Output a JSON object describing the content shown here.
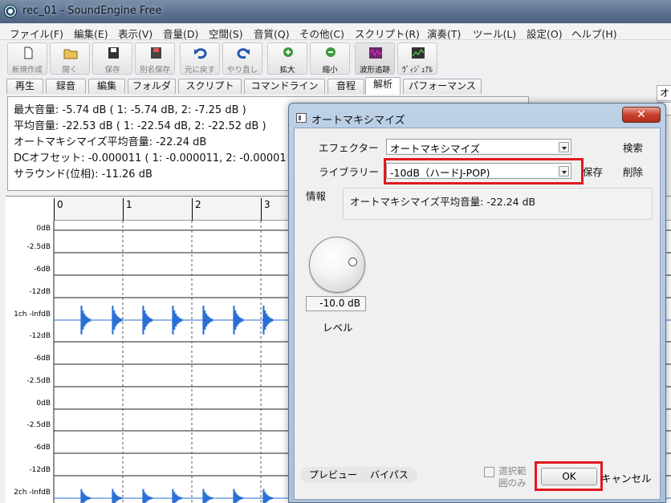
{
  "window": {
    "title": "rec_01 - SoundEngine Free"
  },
  "menu": [
    "ファイル(F)",
    "編集(E)",
    "表示(V)",
    "音量(D)",
    "空間(S)",
    "音質(Q)",
    "その他(C)",
    "スクリプト(R)",
    "演奏(T)",
    "ツール(L)",
    "設定(O)",
    "ヘルプ(H)"
  ],
  "toolbar": {
    "new": "新規作成",
    "open": "開く",
    "save": "保存",
    "save_as": "別名保存",
    "undo": "元に戻す",
    "redo": "やり直し",
    "zoom_in": "拡大",
    "zoom_out": "縮小",
    "wave_follow": "波形追跡",
    "visual": "ｳﾞｨｼﾞｭｱﾙ",
    "right_select": "オ"
  },
  "tabs": [
    "再生",
    "録音",
    "編集",
    "フォルダ",
    "スクリプト",
    "コマンドライン",
    "音程",
    "解析",
    "パフォーマンス"
  ],
  "selected_tab": "解析",
  "analysis": {
    "max_volume": "最大音量: -5.74 dB ( 1: -5.74 dB, 2: -7.25 dB )",
    "avg_volume": "平均音量: -22.53 dB ( 1: -22.54 dB, 2: -22.52 dB )",
    "automax_avg": "オートマキシマイズ平均音量: -22.24 dB",
    "dc_offset": "DCオフセット: -0.000011 ( 1: -0.000011, 2: -0.00001",
    "surround": "サラウンド(位相): -11.26 dB"
  },
  "waveform": {
    "ruler_labels": [
      "0",
      "1",
      "2",
      "3"
    ],
    "db_labels_ch1": [
      "0dB",
      "-2.5dB",
      "-6dB",
      "-12dB",
      "1ch -InfdB",
      "-12dB",
      "-6dB",
      "-2.5dB"
    ],
    "db_labels_ch2": [
      "0dB",
      "-2.5dB",
      "-6dB",
      "-12dB",
      "2ch -InfdB"
    ],
    "wave_color": "#2a6fd6"
  },
  "dialog": {
    "title": "オートマキシマイズ",
    "close": "✕",
    "effector_label": "エフェクター",
    "effector_value": "オートマキシマイズ",
    "search": "検索",
    "library_label": "ライブラリー",
    "library_value": "-10dB（ハードJ-POP)",
    "save": "保存",
    "delete": "削除",
    "info_label": "情報",
    "info_text": "オートマキシマイズ平均音量:  -22.24  dB",
    "knob_value": "-10.0 dB",
    "knob_label": "レベル",
    "preview": "プレビュー",
    "bypass": "バイパス",
    "selection_only": "選択範囲のみ",
    "ok": "OK",
    "cancel": "キャンセル",
    "highlight_color": "#e0191e"
  }
}
